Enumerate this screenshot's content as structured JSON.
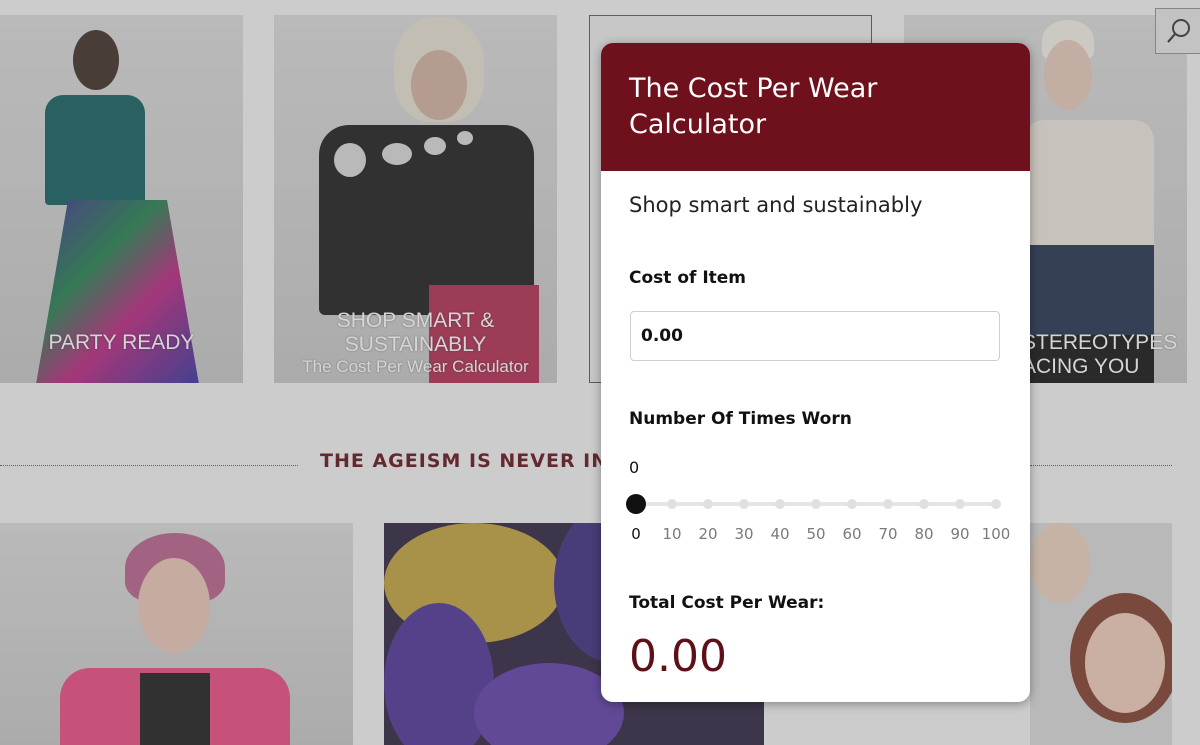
{
  "tiles_top": [
    {
      "caption_big": "PARTY READY",
      "caption_small": ""
    },
    {
      "caption_big": "SHOP SMART & SUSTAINABLY",
      "caption_small": "The Cost Per Wear Calculator"
    },
    {
      "caption_big": "",
      "caption_small": ""
    },
    {
      "caption_big": "STEREOTYPES",
      "caption_small": "ACING YOU"
    }
  ],
  "section": {
    "heading": "THE AGEISM IS NEVER IN"
  },
  "search": {
    "icon": "search-icon"
  },
  "calculator": {
    "title": "The Cost Per Wear Calculator",
    "subtitle": "Shop smart and sustainably",
    "cost_label": "Cost of Item",
    "cost_value": "0.00",
    "times_label": "Number Of Times Worn",
    "times_value": "0",
    "slider": {
      "min": 0,
      "max": 100,
      "value": 0,
      "ticks": [
        "0",
        "10",
        "20",
        "30",
        "40",
        "50",
        "60",
        "70",
        "80",
        "90",
        "100"
      ]
    },
    "total_label": "Total Cost Per Wear:",
    "total_value": "0.00"
  },
  "colors": {
    "brand": "#6e111c",
    "accent_text": "#5e0f17"
  }
}
